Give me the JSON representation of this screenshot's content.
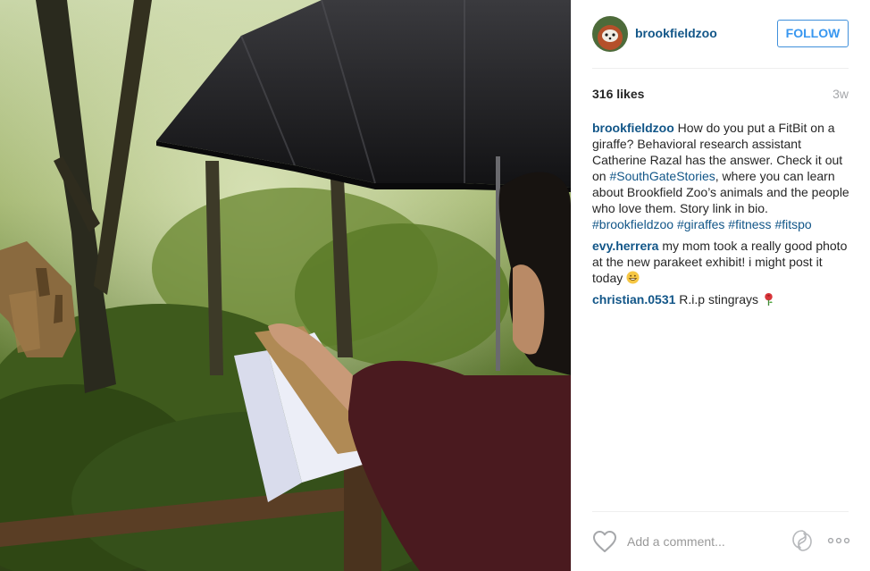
{
  "account": {
    "username": "brookfieldzoo",
    "follow_label": "FOLLOW",
    "avatar_icon": "red-panda-avatar-icon"
  },
  "stats": {
    "likes": "316 likes",
    "posted_ago": "3w"
  },
  "caption": {
    "user": "brookfieldzoo",
    "text_1": " How do you put a FitBit on a giraffe? Behavioral research assistant Catherine Razal has the answer. Check it out on ",
    "hashtag_1": "#SouthGateStories",
    "text_2": ", where you can learn about Brookfield Zoo’s animals and the people who love them. Story link in bio. ",
    "hashtag_2": "#brookfieldzoo",
    "hashtag_3": "#giraffes",
    "hashtag_4": "#fitness",
    "hashtag_5": "#fitspo"
  },
  "comments": [
    {
      "user": "evy.herrera",
      "text": " my mom took a really good photo at the new parakeet exhibit! i might post it today ",
      "emoji": "grinning-face-emoji"
    },
    {
      "user": "christian.0531",
      "text": " R.i.p stingrays ",
      "emoji": "rose-emoji"
    }
  ],
  "footer": {
    "comment_placeholder": "Add a comment...",
    "like_icon": "heart-outline-icon",
    "share_icon": "swirl-icon",
    "more_icon": "more-options-icon"
  },
  "colors": {
    "username_link": "#125688",
    "follow_border": "#4090db",
    "follow_text": "#3897f0",
    "muted": "#a5a7aa"
  }
}
